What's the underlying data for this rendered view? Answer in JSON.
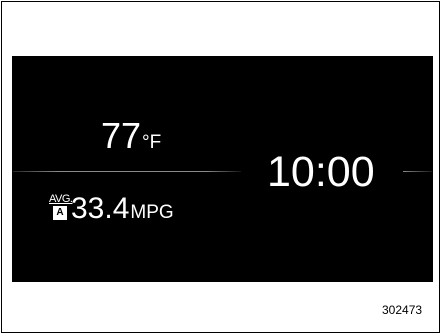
{
  "display": {
    "temperature": {
      "value": "77",
      "unit": "°F"
    },
    "clock": {
      "time": "10:00"
    },
    "fuel_economy": {
      "label": "AVG.",
      "badge": "A",
      "value": "33.4",
      "unit": "MPG"
    }
  },
  "figure_id": "302473"
}
